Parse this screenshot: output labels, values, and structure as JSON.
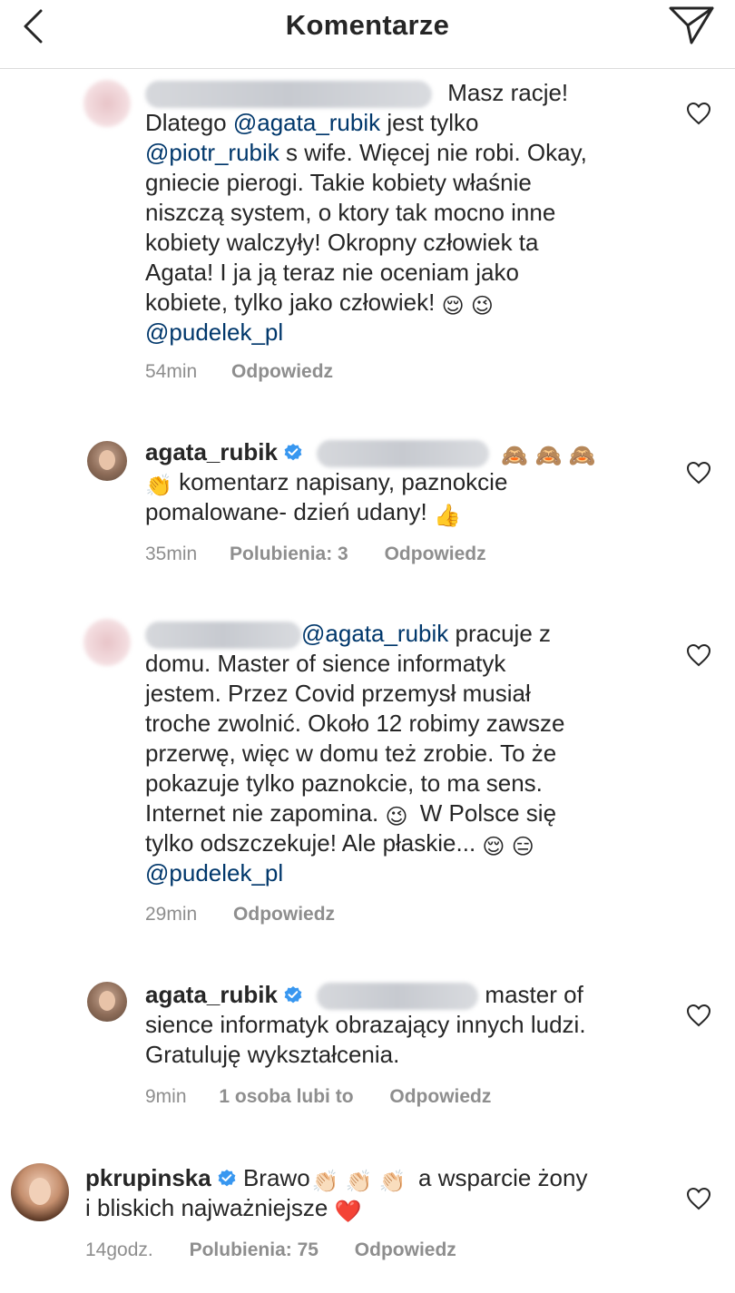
{
  "header": {
    "title": "Komentarze",
    "back_icon": "chevron-left-icon",
    "send_icon": "paper-plane-icon"
  },
  "comments": [
    {
      "lines": [
        "Masz racje!",
        "Dlatego",
        "@agata_rubik",
        "jest tylko",
        "@piotr_rubik",
        "s wife. Więcej nie robi. Okay,",
        "gniecie pierogi. Takie kobiety właśnie",
        "niszczą system, o ktory tak mocno inne",
        "kobiety walczyły! Okropny człowiek ta",
        "Agata! I ja ją teraz nie oceniam jako",
        "kobiete, tylko jako człowiek!",
        "@pudelek_pl"
      ],
      "emojis": [
        "😌",
        "😉"
      ],
      "time": "54min",
      "reply": "Odpowiedz"
    },
    {
      "username": "agata_rubik",
      "emojis_top": [
        "🙈",
        "🙈",
        "🙈"
      ],
      "emoji_clap": "👏",
      "lines": [
        "komentarz napisany, paznokcie",
        "pomalowane- dzień udany!"
      ],
      "emoji_end": "👍",
      "time": "35min",
      "likes": "Polubienia: 3",
      "reply": "Odpowiedz"
    },
    {
      "lines": [
        "@agata_rubik",
        "pracuje z",
        "domu. Master of sience informatyk",
        "jestem. Przez Covid przemysł musiał",
        "troche zwolnić. Około 12 robimy zawsze",
        "przerwę, więc w domu też zrobie. To że",
        "pokazuje tylko paznokcie, to ma sens.",
        "Internet nie zapomina.",
        "W Polsce się",
        "tylko odszczekuje! Ale płaskie...",
        "@pudelek_pl"
      ],
      "emojis": [
        "😉",
        "😌",
        "😑"
      ],
      "time": "29min",
      "reply": "Odpowiedz"
    },
    {
      "username": "agata_rubik",
      "lines": [
        "master of",
        "sience informatyk obrazający innych ludzi.",
        "Gratuluję wykształcenia."
      ],
      "time": "9min",
      "likes": "1 osoba lubi to",
      "reply": "Odpowiedz"
    },
    {
      "username": "pkrupinska",
      "lines": [
        "Brawo",
        "a wsparcie żony",
        "i bliskich najważniejsze"
      ],
      "emojis_clap": [
        "👏🏻",
        "👏🏻",
        "👏🏻"
      ],
      "emoji_heart": "❤️",
      "time": "14godz.",
      "likes": "Polubienia: 75",
      "reply": "Odpowiedz"
    }
  ],
  "icons": {
    "heart": "heart-outline-icon",
    "verified": "verified-badge-icon"
  },
  "colors": {
    "mention": "#00376b",
    "text": "#262626",
    "meta": "#8e8e8e",
    "verified": "#3897f0"
  }
}
